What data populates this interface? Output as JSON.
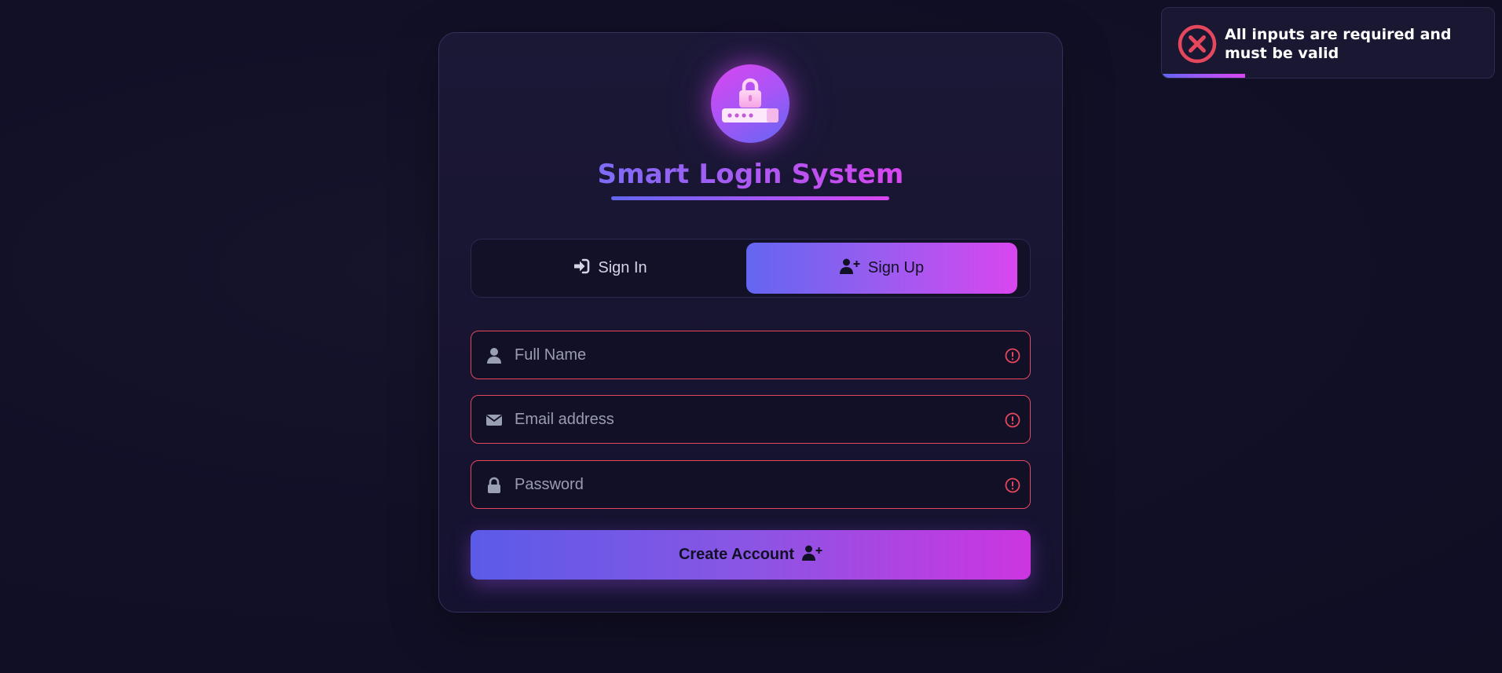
{
  "app": {
    "title": "Smart Login System"
  },
  "tabs": {
    "signin_label": "Sign In",
    "signup_label": "Sign Up",
    "active": "signup"
  },
  "form": {
    "fullname": {
      "placeholder": "Full Name",
      "value": ""
    },
    "email": {
      "placeholder": "Email address",
      "value": ""
    },
    "password": {
      "placeholder": "Password",
      "value": ""
    },
    "submit_label": "Create Account"
  },
  "toast": {
    "message": "All inputs are required and must be valid",
    "type": "error",
    "progress": 0.25
  },
  "icons": {
    "logo": "lock-password-icon",
    "signin": "sign-in-arrow-icon",
    "signup": "user-plus-icon",
    "fullname": "user-icon",
    "email": "envelope-icon",
    "password": "lock-icon",
    "field_error": "exclamation-circle-icon",
    "toast": "x-circle-icon"
  },
  "colors": {
    "accent_start": "#6366f1",
    "accent_mid": "#a855f7",
    "accent_end": "#d946ef",
    "error": "#e5485d",
    "background": "#121027"
  }
}
